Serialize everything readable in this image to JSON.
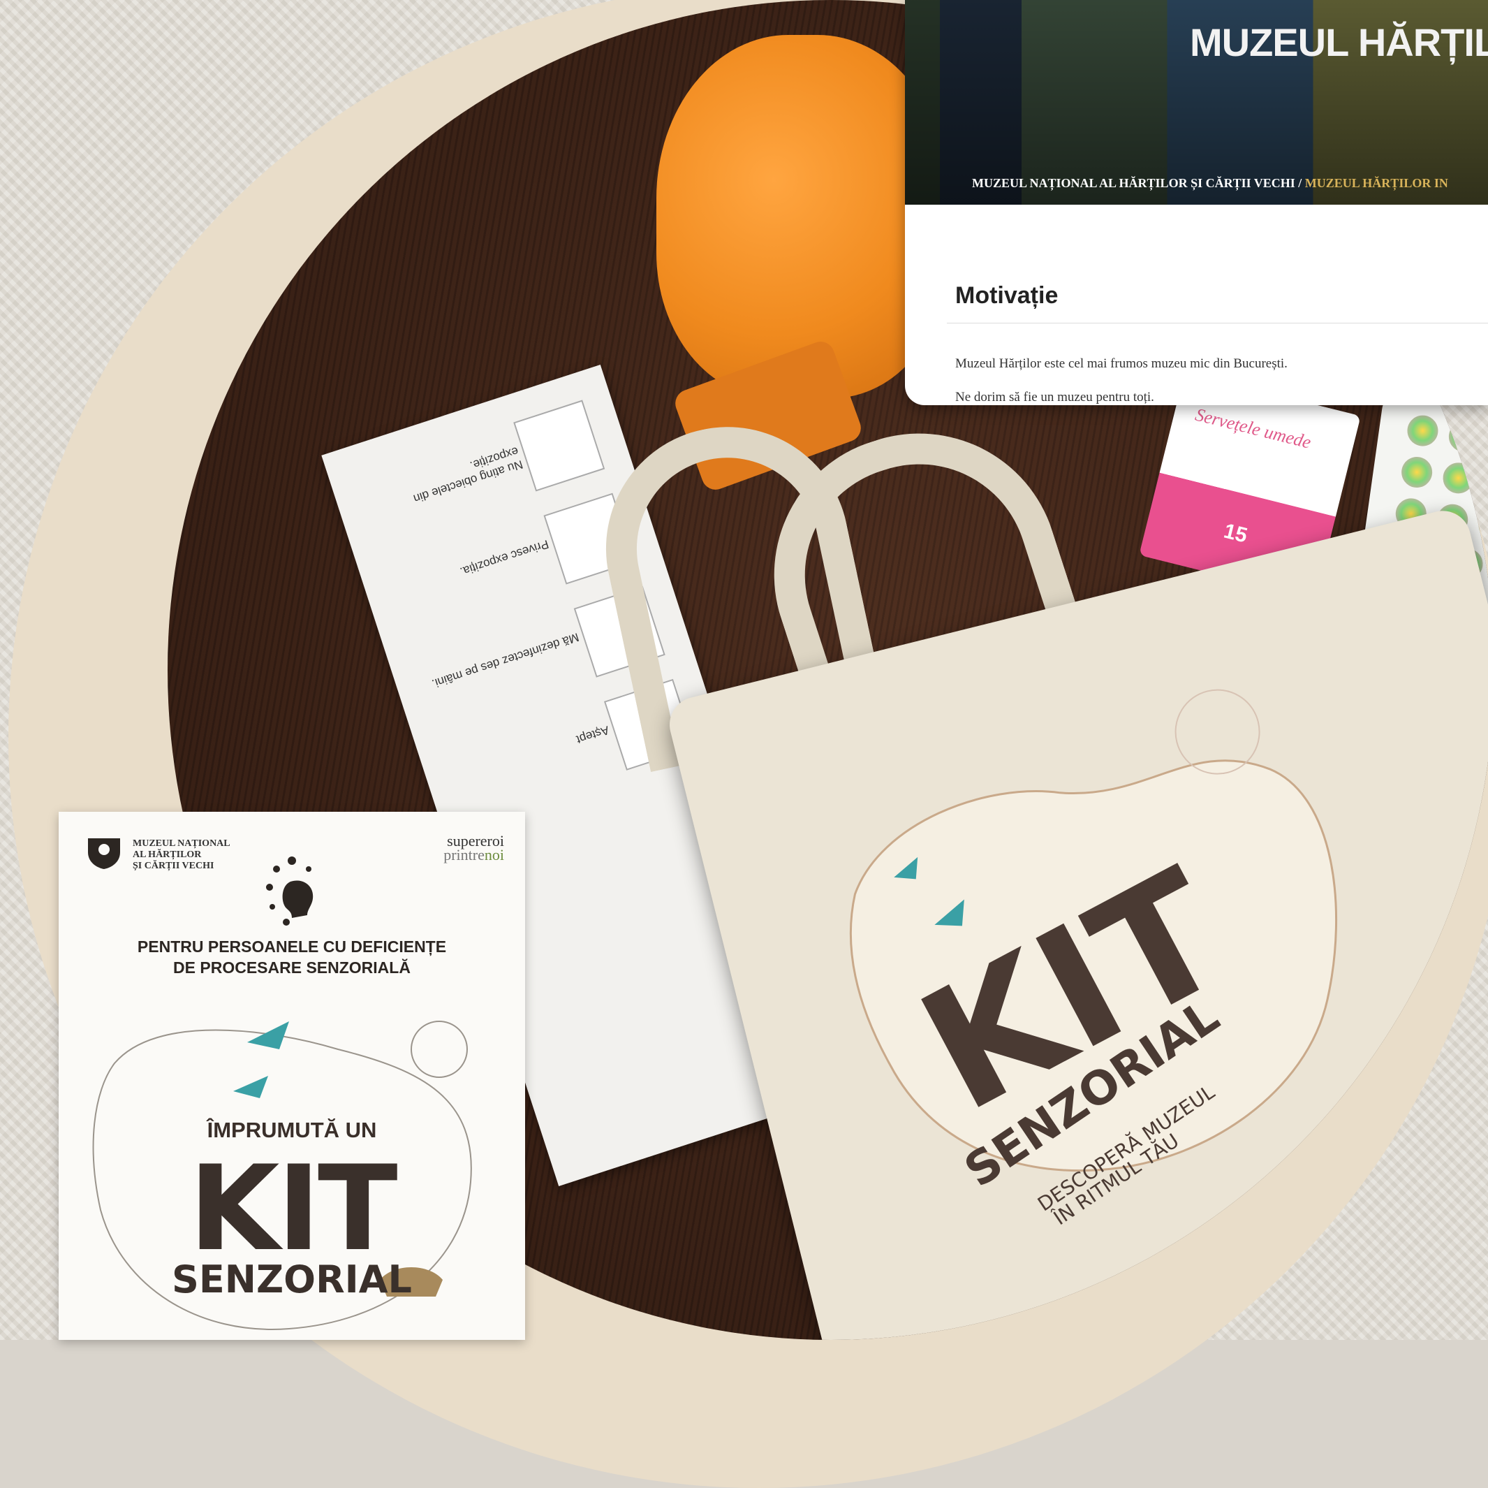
{
  "website": {
    "title": "MUZEUL HĂRȚILO",
    "breadcrumb": {
      "parent": "MUZEUL NAȚIONAL AL HĂRȚILOR ȘI CĂRȚII VECHI",
      "separator": " / ",
      "current": "MUZEUL HĂRȚILOR IN"
    },
    "section_heading": "Motivație",
    "paragraphs": [
      "Muzeul Hărților este cel mai frumos muzeu mic din București.",
      "Ne dorim să fie un muzeu pentru toți."
    ]
  },
  "bag": {
    "kit": "KIT",
    "senzorial": "SENZORIAL",
    "tagline_1": "DESCOPERĂ MUZEUL",
    "tagline_2": "ÎN RITMUL TĂU"
  },
  "wipes": {
    "label": "Servețele umede",
    "count": "15"
  },
  "card": {
    "rules": [
      "Nu ating obiectele din expoziție.",
      "Privesc expoziția.",
      "Mă dezinfectez des pe mâini.",
      "Aștept"
    ]
  },
  "poster": {
    "org_lines": [
      "MUZEUL NAȚIONAL",
      "AL HĂRȚILOR",
      "ȘI CĂRȚII VECHI"
    ],
    "partner_top": "supereroi",
    "partner_bottom_1": "printre",
    "partner_bottom_2": "noi",
    "subtitle_1": "PENTRU PERSOANELE CU DEFICIENȚE",
    "subtitle_2": "DE PROCESARE SENZORIALĂ",
    "borrow": "ÎMPRUMUTĂ UN",
    "kit": "KIT",
    "senzorial": "SENZORIAL"
  },
  "colors": {
    "ring": "#e9ddc9",
    "table": "#3b2217",
    "mitt": "#f08a1e",
    "bag": "#ebe4d5",
    "accent_gold": "#d8b35a",
    "bird_teal": "#3aa0a5"
  }
}
